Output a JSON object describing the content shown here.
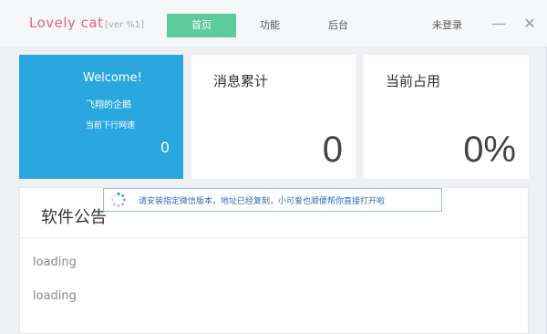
{
  "app": {
    "title": "Lovely cat",
    "version": "[ver %1]"
  },
  "nav": {
    "tabs": [
      {
        "label": "首页",
        "active": true
      },
      {
        "label": "功能",
        "active": false
      },
      {
        "label": "后台",
        "active": false
      }
    ],
    "login_label": "未登录"
  },
  "window_controls": {
    "minimize": "—",
    "close": "✕"
  },
  "stats": {
    "welcome": {
      "title": "Welcome!",
      "subtitle": "飞翔的企鹅",
      "speed_label": "当前下行网速",
      "speed_value": "0"
    },
    "messages": {
      "label": "消息累计",
      "value": "0"
    },
    "usage": {
      "label": "当前占用",
      "value": "0%"
    }
  },
  "announcement": {
    "title": "软件公告",
    "lines": [
      "loading",
      "loading"
    ]
  },
  "toast": {
    "icon": "spinner-icon",
    "message": "请安装指定微信版本，地址已经复制，小可爱也顺便帮你直接打开啦"
  },
  "colors": {
    "brand": "#e8647f",
    "active_tab": "#5ecb9d",
    "welcome_card": "#2aa7de",
    "toast_border": "#8fbfe6",
    "toast_text": "#2f6db6"
  }
}
